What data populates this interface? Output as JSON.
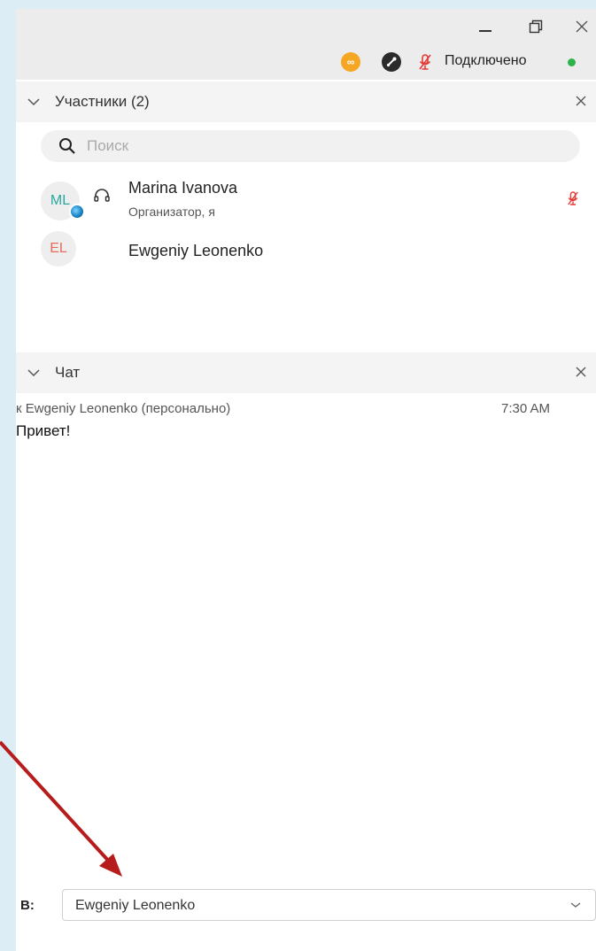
{
  "status": {
    "connection_text": "Подключено",
    "infinity_badge": "∞"
  },
  "participants": {
    "title": "Участники (2)",
    "search_placeholder": "Поиск",
    "list": [
      {
        "initials": "ML",
        "name": "Marina Ivanova",
        "role": "Организатор, я"
      },
      {
        "initials": "EL",
        "name": "Ewgeniy Leonenko",
        "role": ""
      }
    ]
  },
  "chat": {
    "title": "Чат",
    "messages": [
      {
        "to": "к Ewgeniy Leonenko (персонально)",
        "time": "7:30 AM",
        "text": "Привет!"
      }
    ],
    "recipient_label": "В:",
    "recipient_value": "Ewgeniy Leonenko"
  },
  "colors": {
    "accent_red": "#e53935",
    "online_green": "#2eb34a",
    "annotation_arrow": "#b71c1c"
  }
}
